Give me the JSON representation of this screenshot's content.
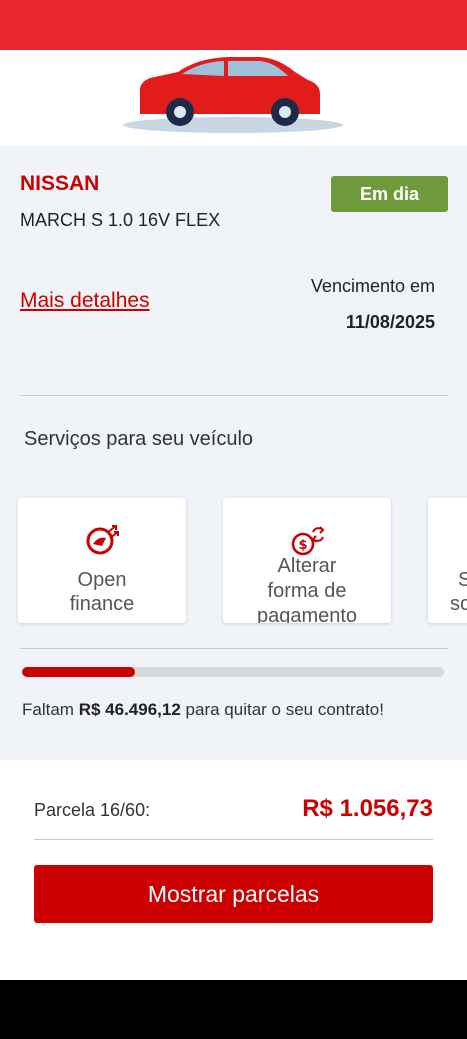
{
  "colors": {
    "accent": "#cc0000",
    "topbar": "#e8262f",
    "status_ok": "#6f9a3c",
    "background": "#f0f4f8"
  },
  "vehicle": {
    "brand": "NISSAN",
    "model": "MARCH S 1.0 16V FLEX",
    "status": "Em dia",
    "details_link": "Mais detalhes",
    "due_label": "Vencimento em",
    "due_date": "11/08/2025"
  },
  "services": {
    "title": "Serviços para seu veículo",
    "cards": [
      {
        "icon": "open-finance-icon",
        "label_line1": "Open",
        "label_line2": "finance"
      },
      {
        "icon": "payment-change-icon",
        "label_line1": "Alterar",
        "label_line2": "forma de",
        "label_line3": "pagamento"
      },
      {
        "icon": "unknown-icon",
        "label_line1": "S",
        "label_line2": "so"
      }
    ]
  },
  "contract": {
    "progress_fraction": 0.267,
    "prefix": "Faltam",
    "amount": "R$ 46.496,12",
    "suffix": "para quitar o seu contrato!"
  },
  "installment": {
    "label": "Parcela 16/60:",
    "value": "R$ 1.056,73",
    "button_label": "Mostrar parcelas"
  }
}
